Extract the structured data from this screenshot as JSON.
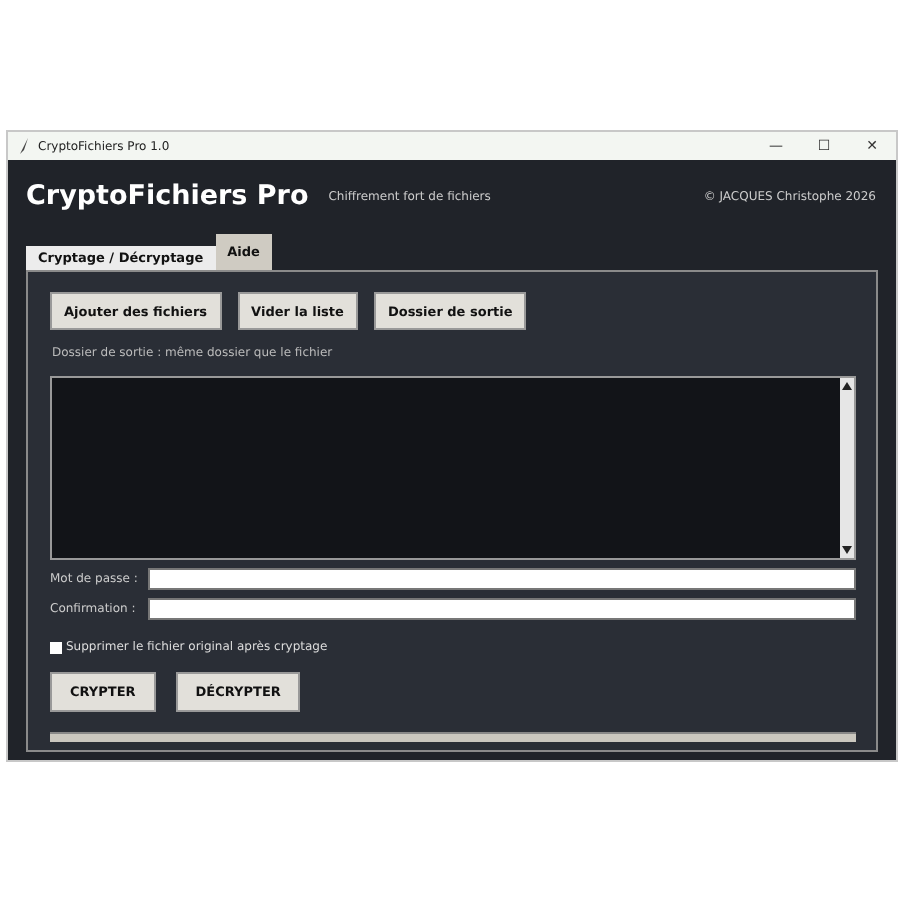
{
  "window": {
    "title": "CryptoFichiers Pro 1.0",
    "controls": [
      "—",
      "☐",
      "✕"
    ]
  },
  "header": {
    "app_name": "CryptoFichiers Pro",
    "tagline": "Chiffrement fort de fichiers",
    "copyright": "© JACQUES Christophe 2026"
  },
  "tabs": [
    {
      "label": "Cryptage / Décryptage",
      "selected": true
    },
    {
      "label": "Aide",
      "selected": false
    }
  ],
  "toolbar": [
    "Ajouter des fichiers",
    "Vider la liste",
    "Dossier de sortie"
  ],
  "output_folder": "Dossier de sortie : même dossier que le fichier",
  "fields": [
    {
      "label": "Mot de passe :"
    },
    {
      "label": "Confirmation :"
    }
  ],
  "delete_original": {
    "label": "Supprimer le fichier original après cryptage",
    "checked": false
  },
  "actions": [
    "CRYPTER",
    "DÉCRYPTER"
  ],
  "progress": {
    "level": 0
  }
}
